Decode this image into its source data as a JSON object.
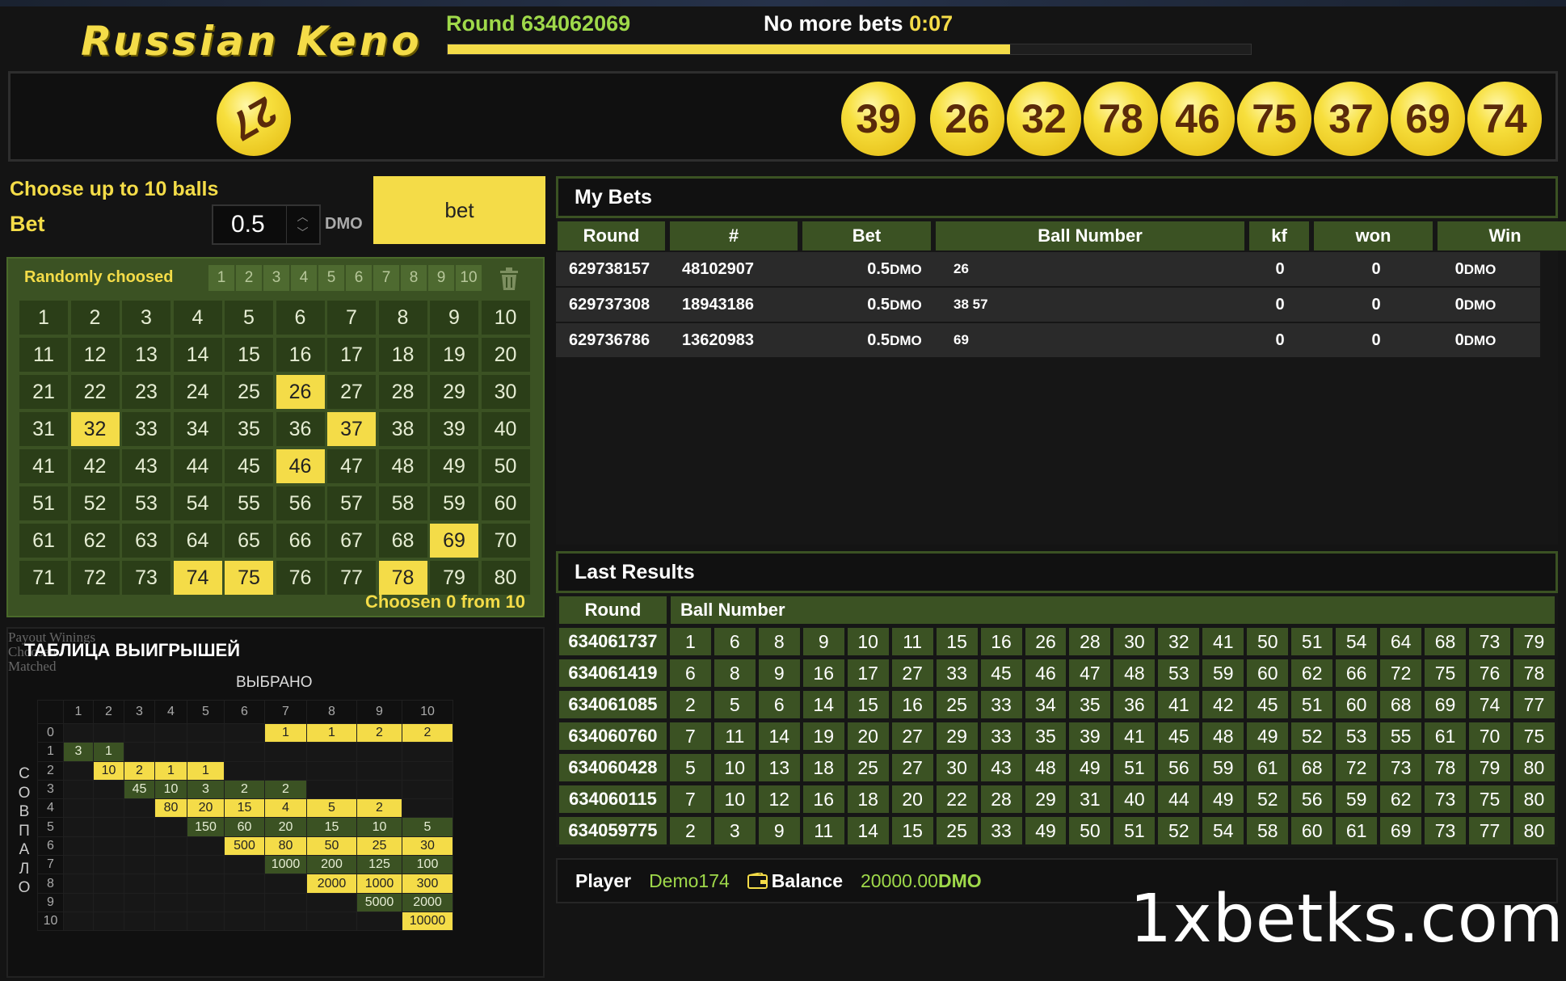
{
  "header": {
    "logo": "Russian Keno",
    "round_label": "Round 634062069",
    "no_more_bets": "No more bets",
    "timer": "0:07",
    "progress_fraction": 0.7
  },
  "drawn_balls": {
    "current_ball": "27",
    "balls": [
      "39",
      "26",
      "32",
      "78",
      "46",
      "75",
      "37",
      "69",
      "74"
    ]
  },
  "controls": {
    "choose_label": "Choose up to 10 balls",
    "bet_label": "Bet",
    "bet_value": "0.5",
    "currency": "DMO",
    "bet_button": "bet"
  },
  "grid": {
    "randomly_label": "Randomly choosed",
    "random_options": [
      "1",
      "2",
      "3",
      "4",
      "5",
      "6",
      "7",
      "8",
      "9",
      "10"
    ],
    "numbers": [
      1,
      2,
      3,
      4,
      5,
      6,
      7,
      8,
      9,
      10,
      11,
      12,
      13,
      14,
      15,
      16,
      17,
      18,
      19,
      20,
      21,
      22,
      23,
      24,
      25,
      26,
      27,
      28,
      29,
      30,
      31,
      32,
      33,
      34,
      35,
      36,
      37,
      38,
      39,
      40,
      41,
      42,
      43,
      44,
      45,
      46,
      47,
      48,
      49,
      50,
      51,
      52,
      53,
      54,
      55,
      56,
      57,
      58,
      59,
      60,
      61,
      62,
      63,
      64,
      65,
      66,
      67,
      68,
      69,
      70,
      71,
      72,
      73,
      74,
      75,
      76,
      77,
      78,
      79,
      80
    ],
    "highlighted": [
      26,
      32,
      37,
      46,
      69,
      74,
      75,
      78
    ],
    "chosen_text": "Choosen 0 from 10"
  },
  "payout": {
    "title": "ТАБЛИЦА ВЫИГРЫШЕЙ",
    "ghost_lines": [
      "Payout Winings",
      "Choosen",
      "Matched"
    ],
    "chosen_label": "ВЫБРАНО",
    "matched_label": [
      "С",
      "О",
      "В",
      "П",
      "А",
      "Л",
      "О"
    ],
    "columns": [
      "1",
      "2",
      "3",
      "4",
      "5",
      "6",
      "7",
      "8",
      "9",
      "10"
    ],
    "rows": [
      {
        "m": "0",
        "cells": [
          "",
          "",
          "",
          "",
          "",
          "",
          "1",
          "1",
          "2",
          "2"
        ],
        "c": [
          "",
          "",
          "",
          "",
          "",
          "",
          "y",
          "y",
          "y",
          "y"
        ]
      },
      {
        "m": "1",
        "cells": [
          "3",
          "1",
          "",
          "",
          "",
          "",
          "",
          "",
          "",
          ""
        ],
        "c": [
          "g",
          "g",
          "",
          "",
          "",
          "",
          "",
          "",
          "",
          ""
        ]
      },
      {
        "m": "2",
        "cells": [
          "",
          "10",
          "2",
          "1",
          "1",
          "",
          "",
          "",
          "",
          ""
        ],
        "c": [
          "",
          "y",
          "y",
          "y",
          "y",
          "",
          "",
          "",
          "",
          ""
        ]
      },
      {
        "m": "3",
        "cells": [
          "",
          "",
          "45",
          "10",
          "3",
          "2",
          "2",
          "",
          "",
          ""
        ],
        "c": [
          "",
          "",
          "g",
          "g",
          "g",
          "g",
          "g",
          "",
          "",
          ""
        ]
      },
      {
        "m": "4",
        "cells": [
          "",
          "",
          "",
          "80",
          "20",
          "15",
          "4",
          "5",
          "2",
          ""
        ],
        "c": [
          "",
          "",
          "",
          "y",
          "y",
          "y",
          "y",
          "y",
          "y",
          ""
        ]
      },
      {
        "m": "5",
        "cells": [
          "",
          "",
          "",
          "",
          "150",
          "60",
          "20",
          "15",
          "10",
          "5"
        ],
        "c": [
          "",
          "",
          "",
          "",
          "g",
          "g",
          "g",
          "g",
          "g",
          "g"
        ]
      },
      {
        "m": "6",
        "cells": [
          "",
          "",
          "",
          "",
          "",
          "500",
          "80",
          "50",
          "25",
          "30"
        ],
        "c": [
          "",
          "",
          "",
          "",
          "",
          "y",
          "y",
          "y",
          "y",
          "y"
        ]
      },
      {
        "m": "7",
        "cells": [
          "",
          "",
          "",
          "",
          "",
          "",
          "1000",
          "200",
          "125",
          "100"
        ],
        "c": [
          "",
          "",
          "",
          "",
          "",
          "",
          "g",
          "g",
          "g",
          "g"
        ]
      },
      {
        "m": "8",
        "cells": [
          "",
          "",
          "",
          "",
          "",
          "",
          "",
          "2000",
          "1000",
          "300"
        ],
        "c": [
          "",
          "",
          "",
          "",
          "",
          "",
          "",
          "y",
          "y",
          "y"
        ]
      },
      {
        "m": "9",
        "cells": [
          "",
          "",
          "",
          "",
          "",
          "",
          "",
          "",
          "5000",
          "2000"
        ],
        "c": [
          "",
          "",
          "",
          "",
          "",
          "",
          "",
          "",
          "g",
          "g"
        ]
      },
      {
        "m": "10",
        "cells": [
          "",
          "",
          "",
          "",
          "",
          "",
          "",
          "",
          "",
          "10000"
        ],
        "c": [
          "",
          "",
          "",
          "",
          "",
          "",
          "",
          "",
          "",
          "y"
        ]
      }
    ]
  },
  "my_bets": {
    "title": "My Bets",
    "columns": [
      "Round",
      "#",
      "Bet",
      "Ball Number",
      "kf",
      "won",
      "Win"
    ],
    "rows": [
      {
        "round": "629738157",
        "id": "48102907",
        "bet": "0.5",
        "balls": "26",
        "kf": "0",
        "won": "0",
        "win": "0"
      },
      {
        "round": "629737308",
        "id": "18943186",
        "bet": "0.5",
        "balls": "38  57",
        "kf": "0",
        "won": "0",
        "win": "0"
      },
      {
        "round": "629736786",
        "id": "13620983",
        "bet": "0.5",
        "balls": "69",
        "kf": "0",
        "won": "0",
        "win": "0"
      }
    ]
  },
  "last_results": {
    "title": "Last Results",
    "columns": [
      "Round",
      "Ball Number"
    ],
    "rows": [
      {
        "round": "634061737",
        "balls": [
          "1",
          "6",
          "8",
          "9",
          "10",
          "11",
          "15",
          "16",
          "26",
          "28",
          "30",
          "32",
          "41",
          "50",
          "51",
          "54",
          "64",
          "68",
          "73",
          "79"
        ]
      },
      {
        "round": "634061419",
        "balls": [
          "6",
          "8",
          "9",
          "16",
          "17",
          "27",
          "33",
          "45",
          "46",
          "47",
          "48",
          "53",
          "59",
          "60",
          "62",
          "66",
          "72",
          "75",
          "76",
          "78"
        ]
      },
      {
        "round": "634061085",
        "balls": [
          "2",
          "5",
          "6",
          "14",
          "15",
          "16",
          "25",
          "33",
          "34",
          "35",
          "36",
          "41",
          "42",
          "45",
          "51",
          "60",
          "68",
          "69",
          "74",
          "77"
        ]
      },
      {
        "round": "634060760",
        "balls": [
          "7",
          "11",
          "14",
          "19",
          "20",
          "27",
          "29",
          "33",
          "35",
          "39",
          "41",
          "45",
          "48",
          "49",
          "52",
          "53",
          "55",
          "61",
          "70",
          "75"
        ]
      },
      {
        "round": "634060428",
        "balls": [
          "5",
          "10",
          "13",
          "18",
          "25",
          "27",
          "30",
          "43",
          "48",
          "49",
          "51",
          "56",
          "59",
          "61",
          "68",
          "72",
          "73",
          "78",
          "79",
          "80"
        ]
      },
      {
        "round": "634060115",
        "balls": [
          "7",
          "10",
          "12",
          "16",
          "18",
          "20",
          "22",
          "28",
          "29",
          "31",
          "40",
          "44",
          "49",
          "52",
          "56",
          "59",
          "62",
          "73",
          "75",
          "80"
        ]
      },
      {
        "round": "634059775",
        "balls": [
          "2",
          "3",
          "9",
          "11",
          "14",
          "15",
          "25",
          "33",
          "49",
          "50",
          "51",
          "52",
          "54",
          "58",
          "60",
          "61",
          "69",
          "73",
          "77",
          "80"
        ]
      }
    ]
  },
  "player": {
    "player_label": "Player",
    "player_name": "Demo174",
    "balance_label": "Balance",
    "balance_value": "20000.00",
    "balance_currency": "DMO"
  },
  "watermark": "1xbetks.com"
}
